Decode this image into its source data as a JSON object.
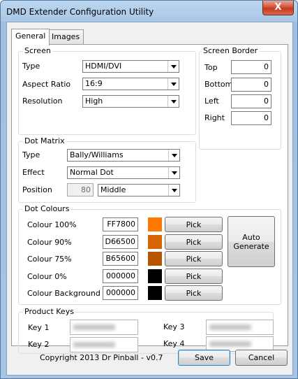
{
  "window": {
    "title": "DMD Extender Configuration Utility",
    "close_glyph": "X"
  },
  "tabs": [
    {
      "label": "General"
    },
    {
      "label": "Images"
    }
  ],
  "screen": {
    "legend": "Screen",
    "type_label": "Type",
    "type_value": "HDMI/DVI",
    "aspect_label": "Aspect Ratio",
    "aspect_value": "16:9",
    "resolution_label": "Resolution",
    "resolution_value": "High"
  },
  "screen_border": {
    "legend": "Screen Border",
    "top_label": "Top",
    "top_value": "0",
    "bottom_label": "Bottom",
    "bottom_value": "0",
    "left_label": "Left",
    "left_value": "0",
    "right_label": "Right",
    "right_value": "0"
  },
  "dot_matrix": {
    "legend": "Dot Matrix",
    "type_label": "Type",
    "type_value": "Bally/Williams",
    "effect_label": "Effect",
    "effect_value": "Normal Dot",
    "position_label": "Position",
    "position_number": "80",
    "position_value": "Middle"
  },
  "dot_colours": {
    "legend": "Dot Colours",
    "rows": [
      {
        "label": "Colour 100%",
        "hex": "FF7800",
        "color": "#FF7800",
        "pick": "Pick"
      },
      {
        "label": "Colour 90%",
        "hex": "D66500",
        "color": "#D66500",
        "pick": "Pick"
      },
      {
        "label": "Colour 75%",
        "hex": "B65600",
        "color": "#B65600",
        "pick": "Pick"
      },
      {
        "label": "Colour 0%",
        "hex": "000000",
        "color": "#000000",
        "pick": "Pick"
      },
      {
        "label": "Colour Background",
        "hex": "000000",
        "color": "#000000",
        "pick": "Pick"
      }
    ],
    "auto_generate": "Auto Generate"
  },
  "product_keys": {
    "legend": "Product Keys",
    "key1": "Key 1",
    "key2": "Key 2",
    "key3": "Key 3",
    "key4": "Key 4"
  },
  "footer": {
    "copyright": "Copyright 2013 Dr Pinball - v0.7",
    "save": "Save",
    "cancel": "Cancel"
  }
}
